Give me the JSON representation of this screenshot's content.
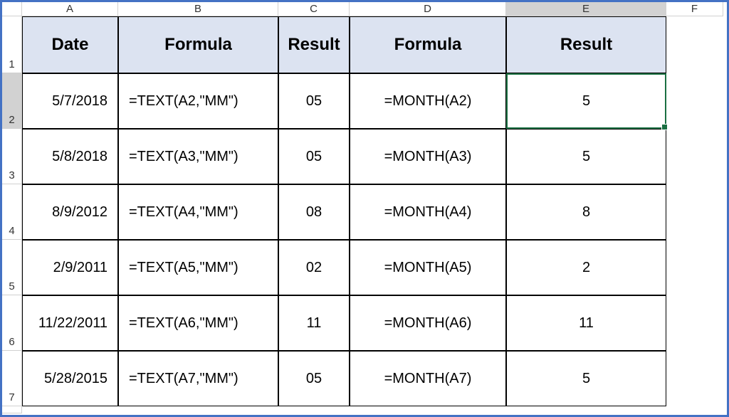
{
  "columns": [
    "A",
    "B",
    "C",
    "D",
    "E",
    "F"
  ],
  "row_numbers": [
    "1",
    "2",
    "3",
    "4",
    "5",
    "6",
    "7"
  ],
  "headers": {
    "A": "Date",
    "B": "Formula",
    "C": "Result",
    "D": "Formula",
    "E": "Result"
  },
  "rows": [
    {
      "date": "5/7/2018",
      "formula1": "=TEXT(A2,\"MM\")",
      "result1": "05",
      "formula2": "=MONTH(A2)",
      "result2": "5"
    },
    {
      "date": "5/8/2018",
      "formula1": "=TEXT(A3,\"MM\")",
      "result1": "05",
      "formula2": "=MONTH(A3)",
      "result2": "5"
    },
    {
      "date": "8/9/2012",
      "formula1": "=TEXT(A4,\"MM\")",
      "result1": "08",
      "formula2": "=MONTH(A4)",
      "result2": "8"
    },
    {
      "date": "2/9/2011",
      "formula1": "=TEXT(A5,\"MM\")",
      "result1": "02",
      "formula2": "=MONTH(A5)",
      "result2": "2"
    },
    {
      "date": "11/22/2011",
      "formula1": "=TEXT(A6,\"MM\")",
      "result1": "11",
      "formula2": "=MONTH(A6)",
      "result2": "11"
    },
    {
      "date": "5/28/2015",
      "formula1": "=TEXT(A7,\"MM\")",
      "result1": "05",
      "formula2": "=MONTH(A7)",
      "result2": "5"
    }
  ],
  "chart_data": {
    "type": "table",
    "title": "Excel Month Extraction Formulas",
    "columns": [
      "Date",
      "Formula",
      "Result",
      "Formula",
      "Result"
    ],
    "data": [
      [
        "5/7/2018",
        "=TEXT(A2,\"MM\")",
        "05",
        "=MONTH(A2)",
        "5"
      ],
      [
        "5/8/2018",
        "=TEXT(A3,\"MM\")",
        "05",
        "=MONTH(A3)",
        "5"
      ],
      [
        "8/9/2012",
        "=TEXT(A4,\"MM\")",
        "08",
        "=MONTH(A4)",
        "8"
      ],
      [
        "2/9/2011",
        "=TEXT(A5,\"MM\")",
        "02",
        "=MONTH(A5)",
        "2"
      ],
      [
        "11/22/2011",
        "=TEXT(A6,\"MM\")",
        "11",
        "=MONTH(A6)",
        "11"
      ],
      [
        "5/28/2015",
        "=TEXT(A7,\"MM\")",
        "05",
        "=MONTH(A7)",
        "5"
      ]
    ]
  }
}
